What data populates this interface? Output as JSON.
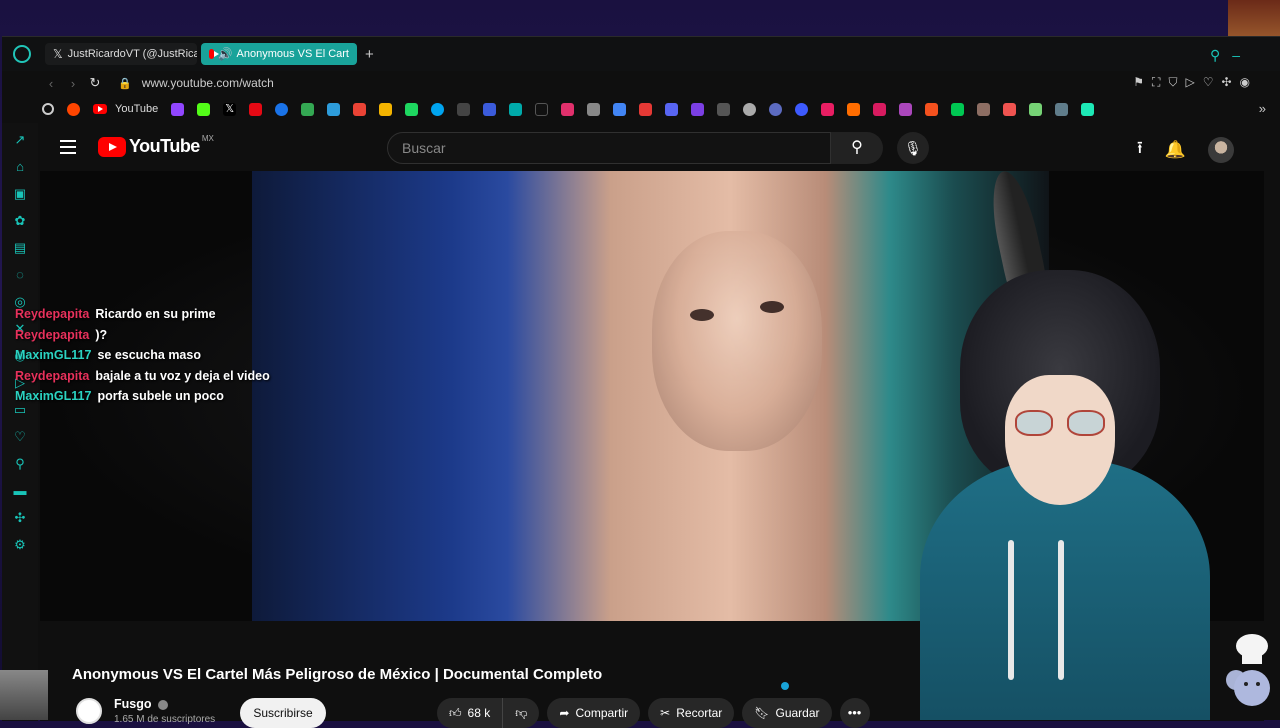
{
  "tabs": [
    {
      "label": "JustRicardoVT (@JustRica",
      "icon": "x-icon",
      "active": false
    },
    {
      "label": "Anonymous VS El Cart",
      "icon": "youtube-icon",
      "active": true
    }
  ],
  "address": {
    "url": "www.youtube.com/watch"
  },
  "bookmarks": {
    "youtube_label": "YouTube"
  },
  "youtube": {
    "logo_text": "YouTube",
    "region": "MX",
    "search_placeholder": "Buscar"
  },
  "video": {
    "title": "Anonymous VS El Cartel Más Peligroso de México | Documental Completo",
    "channel_name": "Fusgo",
    "subscribers": "1.65 M de suscriptores",
    "subscribe_label": "Suscribirse",
    "likes": "68 k",
    "share_label": "Compartir",
    "clip_label": "Recortar",
    "save_label": "Guardar"
  },
  "chat": [
    {
      "user": "Reydepapita",
      "message": "Ricardo en su prime",
      "color": "#e8315c"
    },
    {
      "user": "Reydepapita",
      "message": ")?",
      "color": "#e8315c"
    },
    {
      "user": "MaximGL117",
      "message": "se escucha maso",
      "color": "#2bd3c2"
    },
    {
      "user": "Reydepapita",
      "message": "bajale a tu voz y deja el video",
      "color": "#e8315c"
    },
    {
      "user": "MaximGL117",
      "message": "porfa subele un poco",
      "color": "#2bd3c2"
    }
  ],
  "colors": {
    "accent": "#19a39a",
    "youtube_red": "#ff0000"
  }
}
